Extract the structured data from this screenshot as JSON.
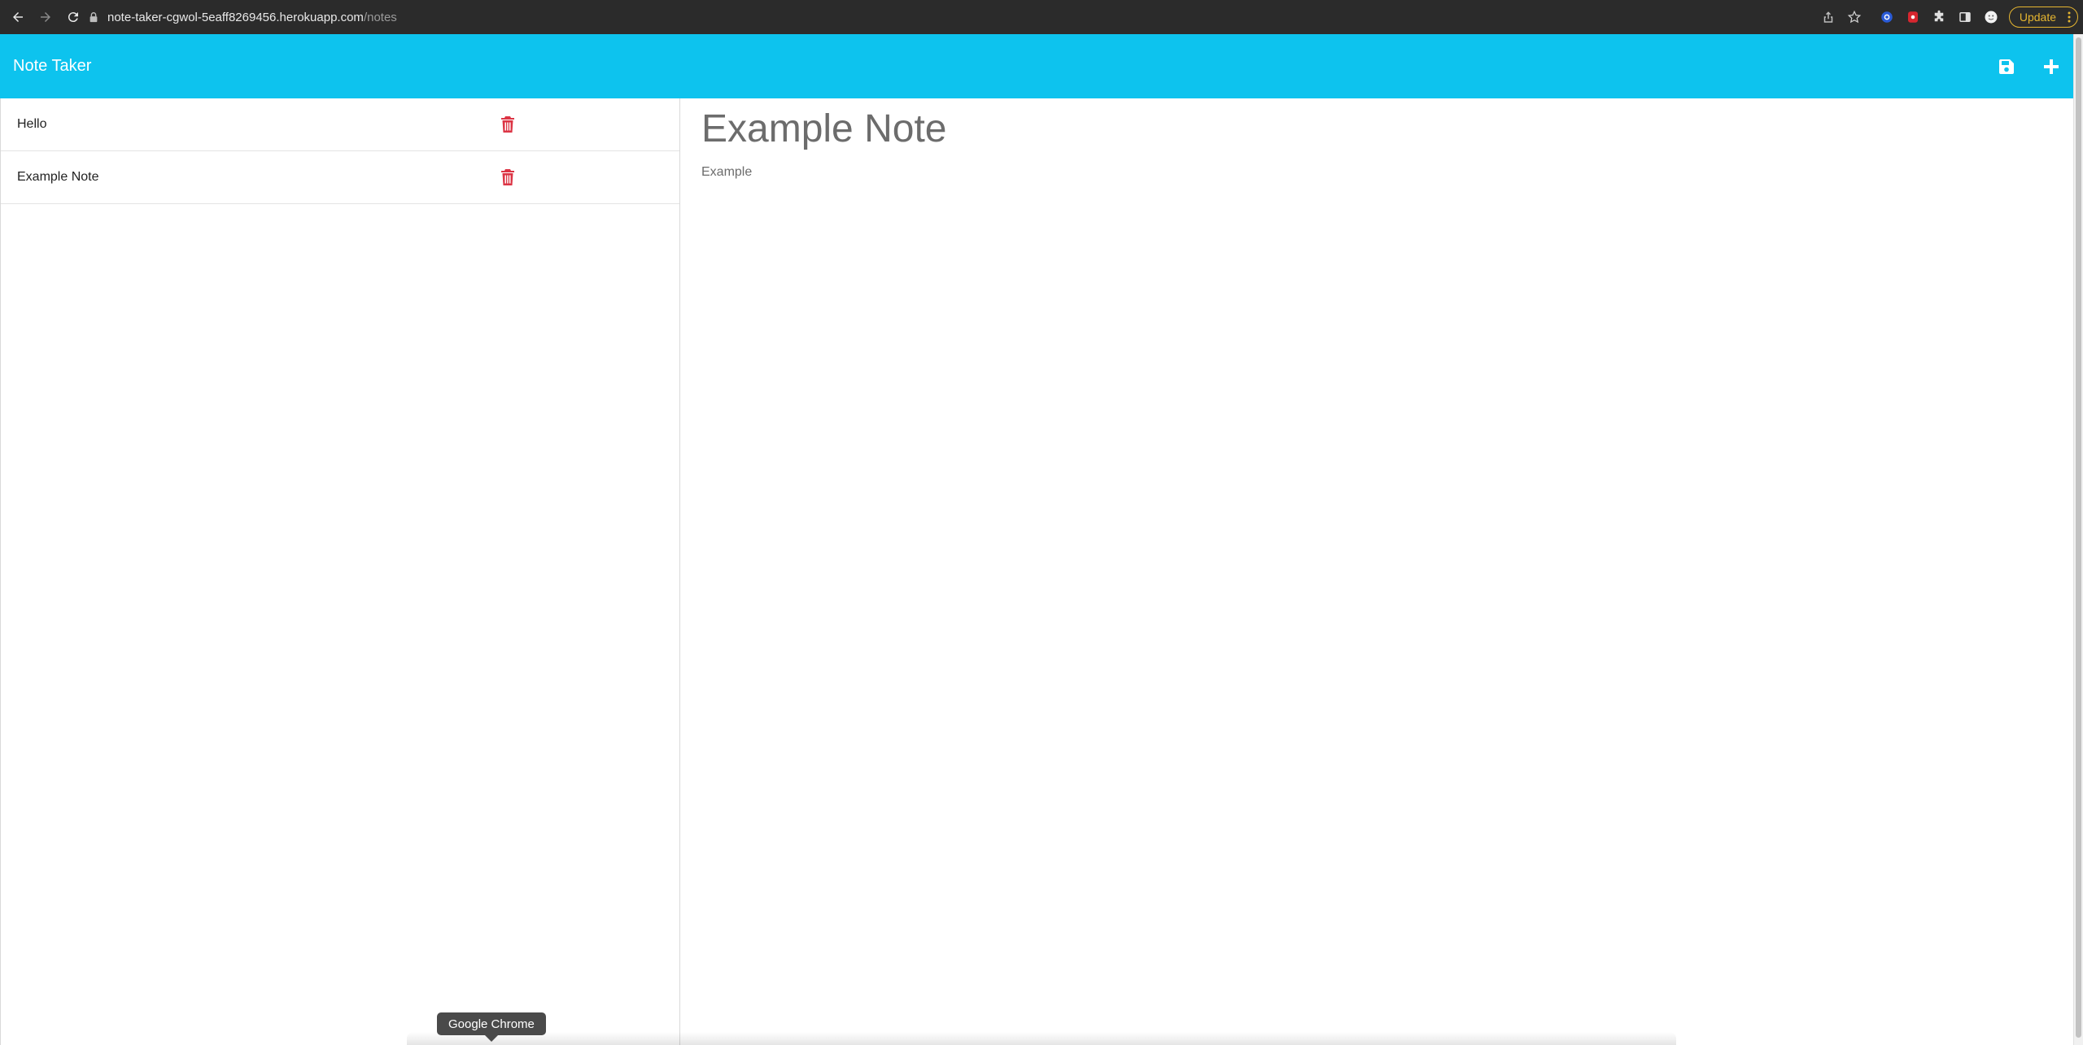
{
  "browser": {
    "url_host": "note-taker-cgwol-5eaff8269456.herokuapp.com",
    "url_path": "/notes",
    "update_label": "Update"
  },
  "app": {
    "brand": "Note Taker",
    "accent_color": "#0dc3ee",
    "delete_color": "#dc3545"
  },
  "notes": [
    {
      "title": "Hello"
    },
    {
      "title": "Example Note"
    }
  ],
  "editor": {
    "title": "Example Note",
    "text": "Example"
  },
  "tooltip": {
    "text": "Google Chrome"
  },
  "icons": {
    "back": "arrow-left-icon",
    "forward": "arrow-right-icon",
    "reload": "reload-icon",
    "lock": "lock-icon",
    "share": "share-icon",
    "bookmark": "star-icon",
    "save": "floppy-disk-icon",
    "new": "plus-icon",
    "delete": "trash-icon"
  }
}
